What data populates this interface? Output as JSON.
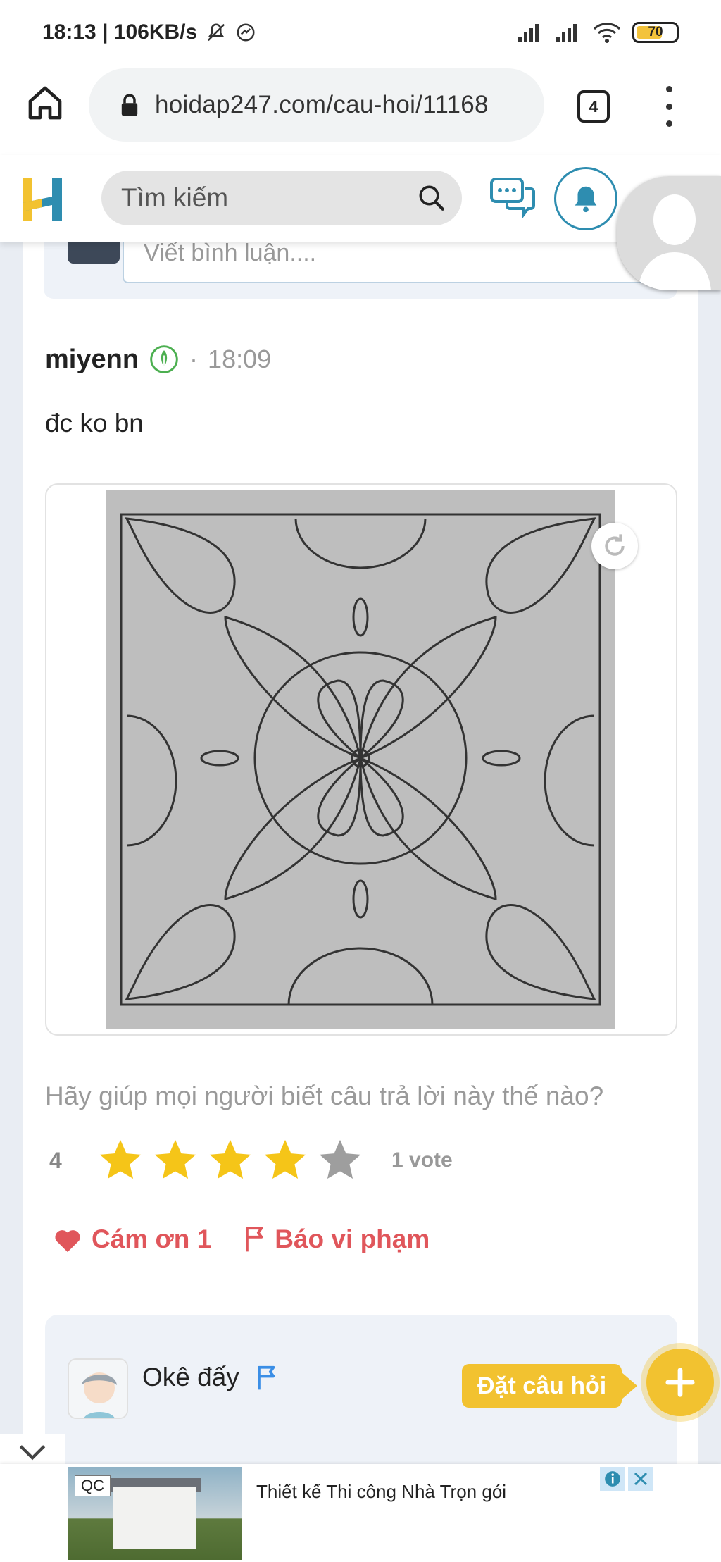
{
  "status_bar": {
    "time_speed": "18:13 | 106KB/s",
    "battery": "70",
    "icons": [
      "mute-icon",
      "messenger-icon",
      "signal-icon",
      "signal-icon",
      "wifi-icon",
      "battery-icon"
    ]
  },
  "browser": {
    "url": "hoidap247.com/cau-hoi/11168",
    "tab_count": "4"
  },
  "header": {
    "search_placeholder": "Tìm kiếm"
  },
  "comment": {
    "placeholder": "Viết bình luận...."
  },
  "answer": {
    "author": "miyenn",
    "time": "18:09",
    "body": "đc ko bn",
    "rating_prompt": "Hãy giúp mọi người biết câu trả lời này thế nào?",
    "rating_value": "4",
    "stars_filled": 4,
    "stars_total": 5,
    "votes": "1 vote",
    "thanks_label": "Cám ơn 1",
    "report_label": "Báo vi phạm"
  },
  "next_answer": {
    "author": "Okê đấy"
  },
  "ask_button": {
    "label": "Đặt câu hỏi"
  },
  "ad": {
    "tag": "QC",
    "text": "Thiết kế Thi công Nhà Trọn gói"
  },
  "colors": {
    "accent_red": "#e0565b",
    "star_yellow": "#f5c518",
    "star_grey": "#9e9e9e",
    "brand_blue": "#2e8db0",
    "ask_yellow": "#f2c230"
  }
}
